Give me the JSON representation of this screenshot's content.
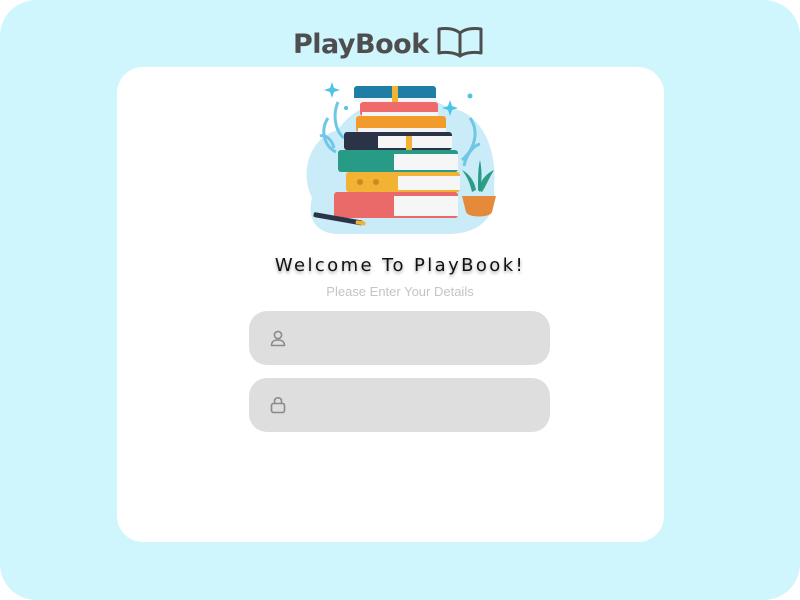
{
  "app": {
    "brand_name": "PlayBook",
    "brand_icon": "open-book-icon"
  },
  "login": {
    "welcome_title": "Welcome To PlayBook!",
    "subtitle": "Please Enter Your  Details",
    "username_field": {
      "value": "",
      "placeholder": "",
      "icon": "user-icon"
    },
    "password_field": {
      "value": "",
      "placeholder": "",
      "icon": "lock-icon"
    }
  },
  "illustration": {
    "icon": "stacked-books-illustration"
  },
  "colors": {
    "page_background": "#cff5fd",
    "card_background": "#ffffff",
    "field_background": "#dedede",
    "brand_text": "#4e4e4e",
    "subtitle_text": "#c4c4c4"
  }
}
